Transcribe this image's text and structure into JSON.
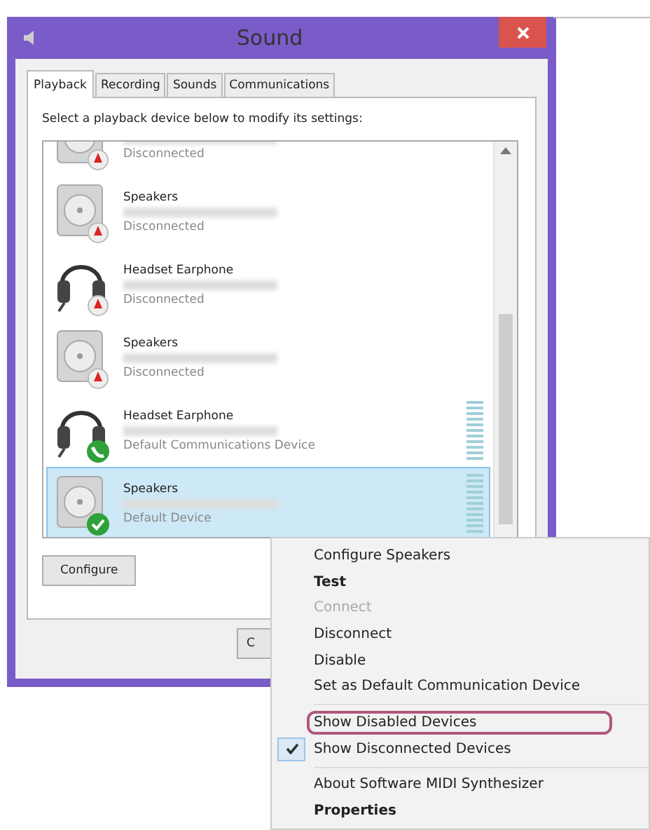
{
  "window": {
    "title": "Sound"
  },
  "tabs": [
    {
      "label": "Playback",
      "selected": true
    },
    {
      "label": "Recording",
      "selected": false
    },
    {
      "label": "Sounds",
      "selected": false
    },
    {
      "label": "Communications",
      "selected": false
    }
  ],
  "instruction": "Select a playback device below to modify its settings:",
  "devices": [
    {
      "kind": "speaker",
      "status": "Disconnected",
      "badge": {
        "kind": "disconnected"
      },
      "meter": false,
      "selected": false
    },
    {
      "kind": "speaker",
      "name": "Speakers",
      "status": "Disconnected",
      "badge": {
        "kind": "disconnected"
      },
      "meter": false,
      "selected": false
    },
    {
      "kind": "headset",
      "name": "Headset Earphone",
      "status": "Disconnected",
      "badge": {
        "kind": "disconnected"
      },
      "meter": false,
      "selected": false
    },
    {
      "kind": "speaker",
      "name": "Speakers",
      "status": "Disconnected",
      "badge": {
        "kind": "disconnected"
      },
      "meter": false,
      "selected": false
    },
    {
      "kind": "headset",
      "name": "Headset Earphone",
      "status": "Default Communications Device",
      "badge": {
        "kind": "phone"
      },
      "meter": true,
      "selected": false
    },
    {
      "kind": "speaker",
      "name": "Speakers",
      "status": "Default Device",
      "badge": {
        "kind": "check"
      },
      "meter": true,
      "selected": true
    }
  ],
  "buttons": [
    {
      "label": "Configure"
    },
    {
      "label": "C"
    }
  ],
  "context_menu": [
    {
      "kind": "item",
      "label": "Configure Speakers",
      "bold": false,
      "disabled": false,
      "checked": false,
      "highlighted": false
    },
    {
      "kind": "item",
      "label": "Test",
      "bold": true,
      "disabled": false,
      "checked": false,
      "highlighted": false
    },
    {
      "kind": "item",
      "label": "Connect",
      "bold": false,
      "disabled": true,
      "checked": false,
      "highlighted": false
    },
    {
      "kind": "item",
      "label": "Disconnect",
      "bold": false,
      "disabled": false,
      "checked": false,
      "highlighted": false
    },
    {
      "kind": "item",
      "label": "Disable",
      "bold": false,
      "disabled": false,
      "checked": false,
      "highlighted": false
    },
    {
      "kind": "item",
      "label": "Set as Default Communication Device",
      "bold": false,
      "disabled": false,
      "checked": false,
      "highlighted": false
    },
    {
      "kind": "separator"
    },
    {
      "kind": "item",
      "label": "Show Disabled Devices",
      "bold": false,
      "disabled": false,
      "checked": false,
      "highlighted": true
    },
    {
      "kind": "item",
      "label": "Show Disconnected Devices",
      "bold": false,
      "disabled": false,
      "checked": true,
      "highlighted": false
    },
    {
      "kind": "separator"
    },
    {
      "kind": "item",
      "label": "About Software MIDI Synthesizer",
      "bold": false,
      "disabled": false,
      "checked": false,
      "highlighted": false
    },
    {
      "kind": "item",
      "label": "Properties",
      "bold": true,
      "disabled": false,
      "checked": false,
      "highlighted": false
    }
  ]
}
